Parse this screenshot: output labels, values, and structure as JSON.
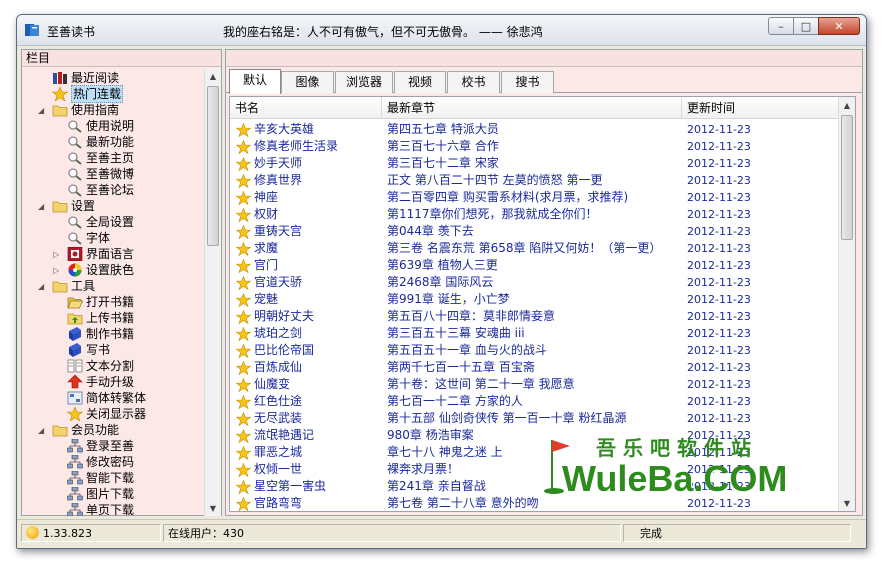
{
  "window": {
    "title": "至善读书",
    "motto": "我的座右铭是：人不可有傲气，但不可无傲骨。 —— 徐悲鸿",
    "controls": {
      "minimize": "–",
      "maximize": "□",
      "close": "✕"
    }
  },
  "left_panel": {
    "header": "栏目",
    "tree": [
      {
        "label": "最近阅读",
        "icon": "book-stack-icon",
        "level": 1
      },
      {
        "label": "热门连载",
        "icon": "star-icon",
        "level": 1,
        "selected": true
      },
      {
        "label": "使用指南",
        "icon": "folder-icon",
        "level": 1,
        "expanded": true
      },
      {
        "label": "使用说明",
        "icon": "magnifier-icon",
        "level": 2
      },
      {
        "label": "最新功能",
        "icon": "magnifier-icon",
        "level": 2
      },
      {
        "label": "至善主页",
        "icon": "magnifier-icon",
        "level": 2
      },
      {
        "label": "至善微博",
        "icon": "magnifier-icon",
        "level": 2
      },
      {
        "label": "至善论坛",
        "icon": "magnifier-icon",
        "level": 2
      },
      {
        "label": "设置",
        "icon": "folder-icon",
        "level": 1,
        "expanded": true
      },
      {
        "label": "全局设置",
        "icon": "magnifier-icon",
        "level": 2
      },
      {
        "label": "字体",
        "icon": "magnifier-icon",
        "level": 2
      },
      {
        "label": "界面语言",
        "icon": "language-icon",
        "level": 2,
        "collapsed": true
      },
      {
        "label": "设置肤色",
        "icon": "color-wheel-icon",
        "level": 2,
        "collapsed": true
      },
      {
        "label": "工具",
        "icon": "folder-icon",
        "level": 1,
        "expanded": true
      },
      {
        "label": "打开书籍",
        "icon": "open-folder-icon",
        "level": 2
      },
      {
        "label": "上传书籍",
        "icon": "upload-folder-icon",
        "level": 2
      },
      {
        "label": "制作书籍",
        "icon": "blue-book-icon",
        "level": 2
      },
      {
        "label": "写书",
        "icon": "blue-book-icon",
        "level": 2
      },
      {
        "label": "文本分割",
        "icon": "split-icon",
        "level": 2
      },
      {
        "label": "手动升级",
        "icon": "upgrade-icon",
        "level": 2
      },
      {
        "label": "简体转繁体",
        "icon": "convert-icon",
        "level": 2
      },
      {
        "label": "关闭显示器",
        "icon": "star-icon",
        "level": 2
      },
      {
        "label": "会员功能",
        "icon": "folder-icon",
        "level": 1,
        "expanded": true
      },
      {
        "label": "登录至善",
        "icon": "network-icon",
        "level": 2
      },
      {
        "label": "修改密码",
        "icon": "network-icon",
        "level": 2
      },
      {
        "label": "智能下载",
        "icon": "network-icon",
        "level": 2
      },
      {
        "label": "图片下载",
        "icon": "network-icon",
        "level": 2
      },
      {
        "label": "单页下载",
        "icon": "network-icon",
        "level": 2
      }
    ]
  },
  "right_panel": {
    "tabs": [
      "默认",
      "图像",
      "浏览器",
      "视频",
      "校书",
      "搜书"
    ],
    "active_tab": 0,
    "columns": [
      "书名",
      "最新章节",
      "更新时间"
    ],
    "rows": [
      [
        "辛亥大英雄",
        "第四五七章 特派大员",
        "2012-11-23"
      ],
      [
        "修真老师生活录",
        "第三百七十六章 合作",
        "2012-11-23"
      ],
      [
        "妙手天师",
        "第三百七十二章 宋家",
        "2012-11-23"
      ],
      [
        "修真世界",
        "正文 第八百二十四节 左莫的愤怒 第一更",
        "2012-11-23"
      ],
      [
        "神座",
        "第二百零四章 购买雷系材料(求月票，求推荐)",
        "2012-11-23"
      ],
      [
        "权财",
        "第1117章你们想死，那我就成全你们！",
        "2012-11-23"
      ],
      [
        "重铸天宫",
        "第044章 羡下去",
        "2012-11-23"
      ],
      [
        "求魔",
        "第三卷 名震东荒 第658章 陷阱又何妨！（第一更）",
        "2012-11-23"
      ],
      [
        "官门",
        "第639章 植物人三更",
        "2012-11-23"
      ],
      [
        "官道天骄",
        "第2468章 国际风云",
        "2012-11-23"
      ],
      [
        "宠魅",
        "第991章 诞生，小亡梦",
        "2012-11-23"
      ],
      [
        "明朝好丈夫",
        "第五百八十四章：莫非郎情妾意",
        "2012-11-23"
      ],
      [
        "琥珀之剑",
        "第三百五十三幕 安魂曲 iii",
        "2012-11-23"
      ],
      [
        "巴比伦帝国",
        "第五百五十一章 血与火的战斗",
        "2012-11-23"
      ],
      [
        "百炼成仙",
        "第两千七百一十五章 百宝斋",
        "2012-11-23"
      ],
      [
        "仙魔变",
        "第十卷：这世间 第二十一章 我愿意",
        "2012-11-23"
      ],
      [
        "红色仕途",
        "第七百一十二章 方家的人",
        "2012-11-23"
      ],
      [
        "无尽武装",
        "第十五部 仙剑奇侠传 第一百一十章 粉红晶源",
        "2012-11-23"
      ],
      [
        "流氓艳遇记",
        "980章 杨浩审案",
        "2012-11-23"
      ],
      [
        "罪恶之城",
        "章七十八 神鬼之迷 上",
        "2012-11-23"
      ],
      [
        "权倾一世",
        "裸奔求月票！",
        "2012-11-23"
      ],
      [
        "星空第一害虫",
        "第241章 亲自督战",
        "2012-11-23"
      ],
      [
        "官路弯弯",
        "第七卷 第二十八章 意外的吻",
        "2012-11-23"
      ]
    ]
  },
  "statusbar": {
    "version": "1.33.823",
    "online_users": "在线用户：430",
    "status": "完成"
  },
  "watermark": {
    "cn": "吾乐吧软件站",
    "en": "WuleBa.COM"
  },
  "colors": {
    "panel_bg": "#fde8e8",
    "link_text": "#1a2a9a",
    "watermark": "#2e8b1e"
  }
}
